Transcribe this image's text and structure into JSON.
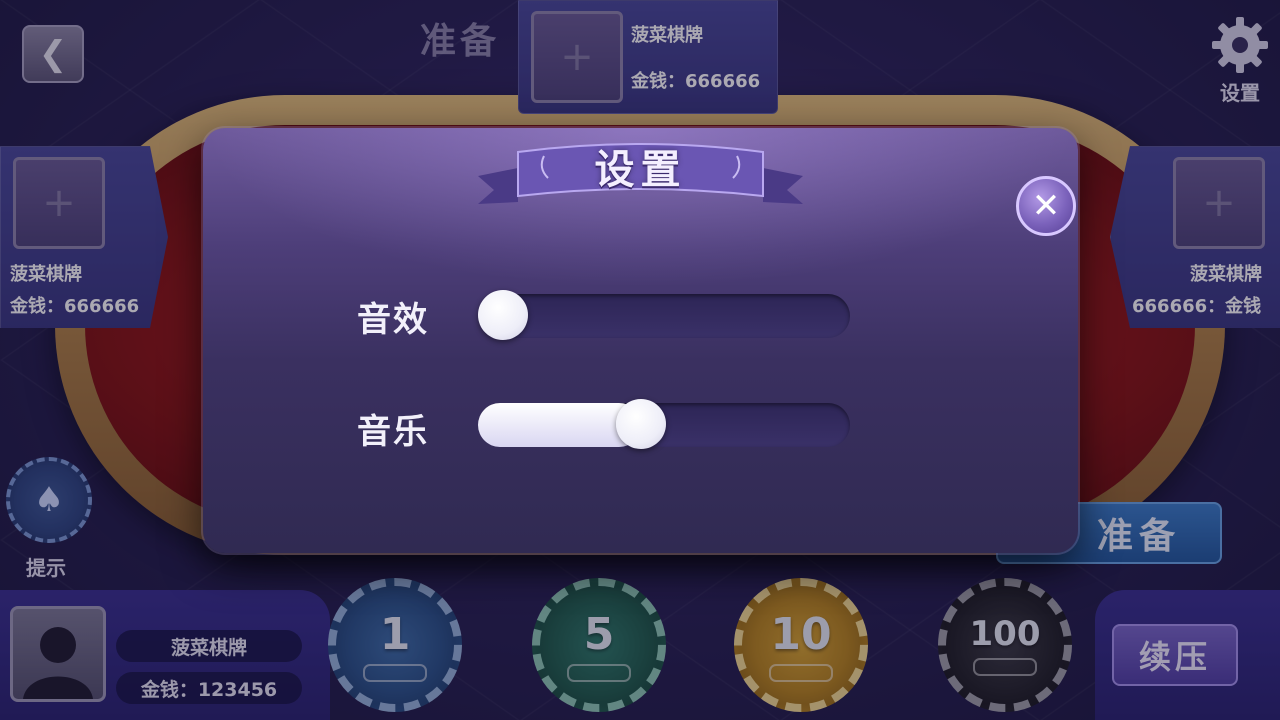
{
  "header": {
    "back_icon": "chevron-left-icon",
    "settings_label": "设置",
    "settings_icon": "gear-icon"
  },
  "seats": {
    "top": {
      "name": "菠菜棋牌",
      "money": "金钱：666666",
      "ready": "准备"
    },
    "left": {
      "name": "菠菜棋牌",
      "money": "金钱：666666"
    },
    "right": {
      "name": "菠菜棋牌",
      "money": "666666：金钱"
    }
  },
  "side": {
    "hint_label": "提示",
    "ready_button": "准备"
  },
  "player": {
    "name": "菠菜棋牌",
    "money": "金钱：123456"
  },
  "chips": [
    {
      "value": "1",
      "color": "#2c548a"
    },
    {
      "value": "5",
      "color": "#22604f"
    },
    {
      "value": "10",
      "color": "#b9861f"
    },
    {
      "value": "100",
      "color": "#26262c"
    }
  ],
  "rebet_button": "续压",
  "settings_modal": {
    "title": "设置",
    "close_icon": "close-icon",
    "sound_label": "音效",
    "sound_level": 0.0,
    "music_label": "音乐",
    "music_level": 0.43
  }
}
